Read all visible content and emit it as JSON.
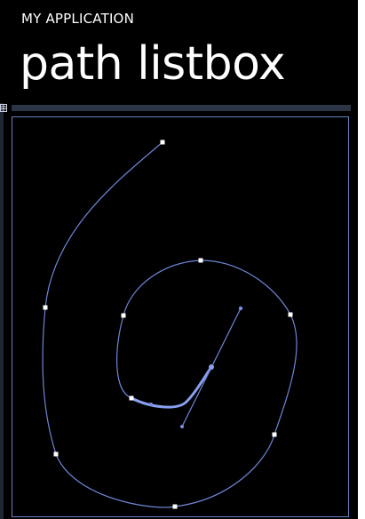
{
  "header": {
    "app_title": "MY APPLICATION",
    "page_title": "path listbox"
  },
  "colors": {
    "background": "#000000",
    "text": "#ffffff",
    "path_stroke": "#7b8fe0",
    "path_highlight": "#8aa0f0",
    "handle_fill": "#ffffff",
    "control_point": "#7b8fe0",
    "listbox_border": "#6b7fc2",
    "header_bar": "#2b3546"
  },
  "listbox": {
    "role": "path-listbox",
    "item_marker_icon": "square-handle-icon",
    "control_point_icon": "circle-handle-icon"
  }
}
